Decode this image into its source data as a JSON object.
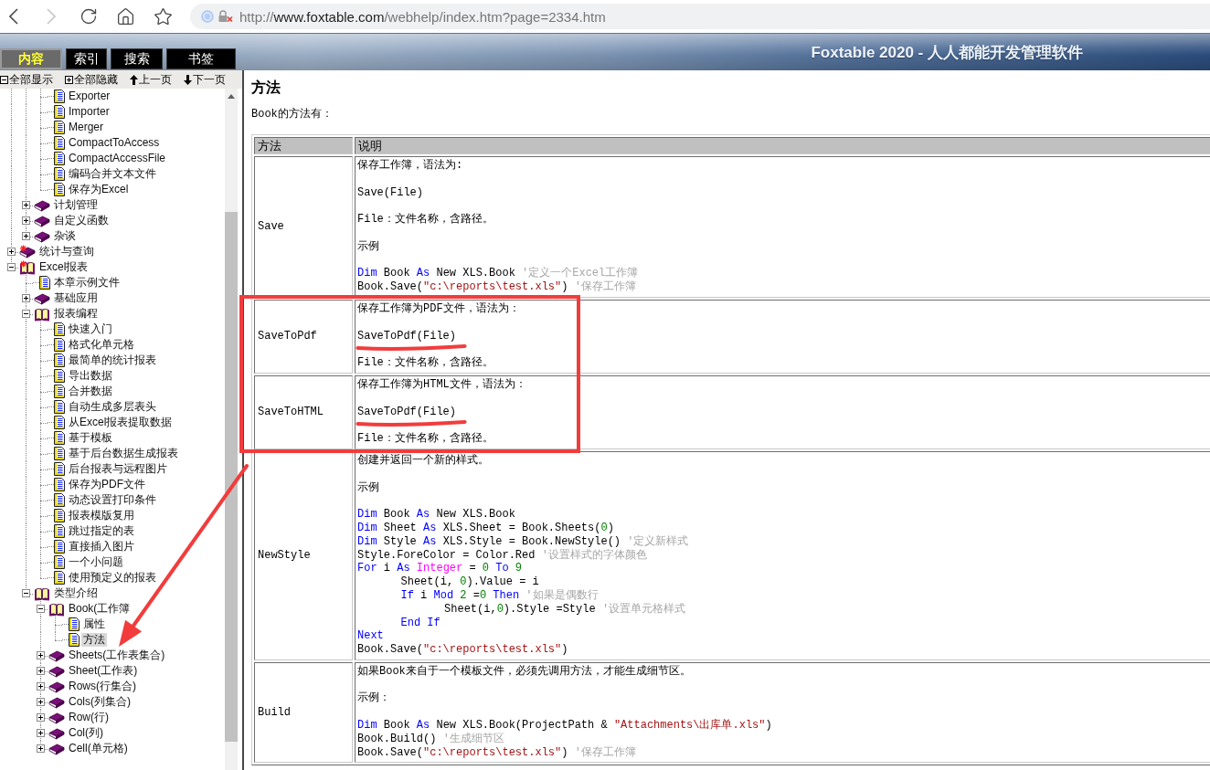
{
  "browser": {
    "back": {
      "disabled": false
    },
    "forward": {
      "disabled": true
    },
    "url": {
      "scheme": "http://",
      "host": "www.foxtable.com",
      "path": "/webhelp/index.htm?page=2334.htm"
    }
  },
  "header": {
    "tabs": [
      {
        "label": "内容",
        "selected": true
      },
      {
        "label": "索引",
        "selected": false
      },
      {
        "label": "搜索",
        "selected": false
      },
      {
        "label": "书签",
        "selected": false
      }
    ],
    "title": "Foxtable 2020 - 人人都能开发管理软件"
  },
  "sidebar": {
    "toolbar": [
      {
        "label": "全部显示",
        "kind": "minus"
      },
      {
        "label": "全部隐藏",
        "kind": "plus"
      },
      {
        "label": "上一页",
        "kind": "up"
      },
      {
        "label": "下一页",
        "kind": "down"
      }
    ],
    "tree": [
      {
        "children": [
          {
            "children": [
              {
                "label": "Exporter",
                "kind": "page",
                "selected": false
              },
              {
                "label": "Importer",
                "kind": "page",
                "selected": false
              },
              {
                "label": "Merger",
                "kind": "page",
                "selected": false
              },
              {
                "label": "CompactToAccess",
                "kind": "page",
                "selected": false
              },
              {
                "label": "CompactAccessFile",
                "kind": "page",
                "selected": false
              },
              {
                "label": "编码合并文本文件",
                "kind": "page",
                "selected": false
              },
              {
                "label": "保存为Excel",
                "kind": "page",
                "selected": false
              }
            ]
          },
          {
            "label": "计划管理",
            "kind": "book",
            "expanded": false,
            "selected": false
          },
          {
            "label": "自定义函数",
            "kind": "book",
            "expanded": false,
            "selected": false
          },
          {
            "label": "杂谈",
            "kind": "book",
            "expanded": false,
            "selected": false
          }
        ]
      },
      {
        "label": "统计与查询",
        "kind": "chapter",
        "expanded": false,
        "selected": false
      },
      {
        "label": "Excel报表",
        "kind": "chapter",
        "expanded": true,
        "selected": false,
        "children": [
          {
            "label": "本章示例文件",
            "kind": "page",
            "selected": false
          },
          {
            "label": "基础应用",
            "kind": "book",
            "expanded": false,
            "selected": false
          },
          {
            "label": "报表编程",
            "kind": "book",
            "expanded": true,
            "selected": false,
            "children": [
              {
                "label": "快速入门",
                "kind": "page",
                "selected": false
              },
              {
                "label": "格式化单元格",
                "kind": "page",
                "selected": false
              },
              {
                "label": "最简单的统计报表",
                "kind": "page",
                "selected": false
              },
              {
                "label": "导出数据",
                "kind": "page",
                "selected": false
              },
              {
                "label": "合并数据",
                "kind": "page",
                "selected": false
              },
              {
                "label": "自动生成多层表头",
                "kind": "page",
                "selected": false
              },
              {
                "label": "从Excel报表提取数据",
                "kind": "page",
                "selected": false
              },
              {
                "label": "基于模板",
                "kind": "page",
                "selected": false
              },
              {
                "label": "基于后台数据生成报表",
                "kind": "page",
                "selected": false
              },
              {
                "label": "后台报表与远程图片",
                "kind": "page",
                "selected": false
              },
              {
                "label": "保存为PDF文件",
                "kind": "page",
                "selected": false
              },
              {
                "label": "动态设置打印条件",
                "kind": "page",
                "selected": false
              },
              {
                "label": "报表模版复用",
                "kind": "page",
                "selected": false
              },
              {
                "label": "跳过指定的表",
                "kind": "page",
                "selected": false
              },
              {
                "label": "直接插入图片",
                "kind": "page",
                "selected": false
              },
              {
                "label": "一个小问题",
                "kind": "page",
                "selected": false
              },
              {
                "label": "使用预定义的报表",
                "kind": "page",
                "selected": false
              }
            ]
          },
          {
            "label": "类型介绍",
            "kind": "book",
            "expanded": true,
            "selected": false,
            "children": [
              {
                "label": "Book(工作簿",
                "kind": "book",
                "expanded": true,
                "selected": false,
                "children": [
                  {
                    "label": "属性",
                    "kind": "page",
                    "selected": false
                  },
                  {
                    "label": "方法",
                    "kind": "page",
                    "selected": true
                  }
                ]
              },
              {
                "label": "Sheets(工作表集合)",
                "kind": "book",
                "expanded": false,
                "selected": false
              },
              {
                "label": "Sheet(工作表)",
                "kind": "book",
                "expanded": false,
                "selected": false
              },
              {
                "label": "Rows(行集合)",
                "kind": "book",
                "expanded": false,
                "selected": false
              },
              {
                "label": "Cols(列集合)",
                "kind": "book",
                "expanded": false,
                "selected": false
              },
              {
                "label": "Row(行)",
                "kind": "book",
                "expanded": false,
                "selected": false
              },
              {
                "label": "Col(列)",
                "kind": "book",
                "expanded": false,
                "selected": false
              },
              {
                "label": "Cell(单元格)",
                "kind": "book",
                "expanded": false,
                "selected": false
              }
            ]
          }
        ]
      }
    ]
  },
  "content": {
    "title": "方法",
    "intro": "Book的方法有：",
    "table": {
      "columns": [
        "方法",
        "说明"
      ],
      "rows": [
        {
          "method": "Save",
          "highlighted": false,
          "blocks": [
            {
              "kind": "text",
              "text": "保存工作簿，语法为:",
              "underlined": false
            },
            {
              "kind": "text",
              "text": "Save(File)",
              "underlined": false
            },
            {
              "kind": "text",
              "text": "File：文件名称，含路径。",
              "underlined": false
            },
            {
              "kind": "text",
              "text": "示例",
              "underlined": false
            },
            {
              "kind": "code",
              "lines": [
                {
                  "tokens": [
                    {
                      "kind": "keyword",
                      "text": "Dim"
                    },
                    {
                      "kind": "plain",
                      "text": " Book "
                    },
                    {
                      "kind": "keyword",
                      "text": "As"
                    },
                    {
                      "kind": "plain",
                      "text": " New XLS.Book "
                    },
                    {
                      "kind": "comment",
                      "text": "'定义一个Excel工作簿"
                    }
                  ]
                },
                {
                  "tokens": [
                    {
                      "kind": "plain",
                      "text": "Book.Save("
                    },
                    {
                      "kind": "string",
                      "text": "\"c:\\reports\\test.xls\""
                    },
                    {
                      "kind": "plain",
                      "text": ") "
                    },
                    {
                      "kind": "comment",
                      "text": "'保存工作簿"
                    }
                  ]
                }
              ]
            }
          ]
        },
        {
          "method": "SaveToPdf",
          "highlighted": true,
          "blocks": [
            {
              "kind": "text",
              "text": "保存工作簿为PDF文件，语法为：",
              "underlined": false
            },
            {
              "kind": "text",
              "text": "SaveToPdf(File)",
              "underlined": true
            },
            {
              "kind": "text",
              "text": "File：文件名称，含路径。",
              "underlined": false
            }
          ]
        },
        {
          "method": "SaveToHTML",
          "highlighted": true,
          "blocks": [
            {
              "kind": "text",
              "text": "保存工作簿为HTML文件，语法为：",
              "underlined": false
            },
            {
              "kind": "text",
              "text": "SaveToPdf(File)",
              "underlined": true
            },
            {
              "kind": "text",
              "text": "File：文件名称，含路径。",
              "underlined": false
            }
          ]
        },
        {
          "method": "NewStyle",
          "highlighted": false,
          "blocks": [
            {
              "kind": "text",
              "text": "创建并返回一个新的样式。",
              "underlined": false
            },
            {
              "kind": "text",
              "text": "示例",
              "underlined": false
            },
            {
              "kind": "code",
              "lines": [
                {
                  "tokens": [
                    {
                      "kind": "keyword",
                      "text": "Dim"
                    },
                    {
                      "kind": "plain",
                      "text": " Book "
                    },
                    {
                      "kind": "keyword",
                      "text": "As"
                    },
                    {
                      "kind": "plain",
                      "text": " New XLS.Book"
                    }
                  ]
                },
                {
                  "tokens": [
                    {
                      "kind": "keyword",
                      "text": "Dim"
                    },
                    {
                      "kind": "plain",
                      "text": " Sheet "
                    },
                    {
                      "kind": "keyword",
                      "text": "As"
                    },
                    {
                      "kind": "plain",
                      "text": " XLS.Sheet = Book.Sheets("
                    },
                    {
                      "kind": "number",
                      "text": "0"
                    },
                    {
                      "kind": "plain",
                      "text": ")"
                    }
                  ]
                },
                {
                  "tokens": [
                    {
                      "kind": "keyword",
                      "text": "Dim"
                    },
                    {
                      "kind": "plain",
                      "text": " Style "
                    },
                    {
                      "kind": "keyword",
                      "text": "As"
                    },
                    {
                      "kind": "plain",
                      "text": " XLS.Style = Book.NewStyle() "
                    },
                    {
                      "kind": "comment",
                      "text": "'定义新样式"
                    }
                  ]
                },
                {
                  "tokens": [
                    {
                      "kind": "plain",
                      "text": "Style.ForeColor = Color.Red "
                    },
                    {
                      "kind": "comment",
                      "text": "'设置样式的字体颜色"
                    }
                  ]
                },
                {
                  "tokens": [
                    {
                      "kind": "keyword",
                      "text": "For"
                    },
                    {
                      "kind": "plain",
                      "text": " i "
                    },
                    {
                      "kind": "keyword",
                      "text": "As"
                    },
                    {
                      "kind": "type",
                      "text": " Integer"
                    },
                    {
                      "kind": "plain",
                      "text": " = "
                    },
                    {
                      "kind": "number",
                      "text": "0"
                    },
                    {
                      "kind": "keyword",
                      "text": " To"
                    },
                    {
                      "kind": "number",
                      "text": " 9"
                    }
                  ],
                  "children": [
                    {
                      "tokens": [
                        {
                          "kind": "plain",
                          "text": "Sheet(i, "
                        },
                        {
                          "kind": "number",
                          "text": "0"
                        },
                        {
                          "kind": "plain",
                          "text": ").Value = i"
                        }
                      ]
                    },
                    {
                      "tokens": [
                        {
                          "kind": "keyword",
                          "text": "If"
                        },
                        {
                          "kind": "plain",
                          "text": " i "
                        },
                        {
                          "kind": "keyword",
                          "text": "Mod"
                        },
                        {
                          "kind": "number",
                          "text": " 2"
                        },
                        {
                          "kind": "plain",
                          "text": " ="
                        },
                        {
                          "kind": "number",
                          "text": "0"
                        },
                        {
                          "kind": "keyword",
                          "text": " Then"
                        },
                        {
                          "kind": "comment",
                          "text": " '如果是偶数行"
                        }
                      ],
                      "children": [
                        {
                          "tokens": [
                            {
                              "kind": "plain",
                              "text": "Sheet(i,"
                            },
                            {
                              "kind": "number",
                              "text": "0"
                            },
                            {
                              "kind": "plain",
                              "text": ").Style =Style "
                            },
                            {
                              "kind": "comment",
                              "text": "'设置单元格样式"
                            }
                          ]
                        }
                      ]
                    },
                    {
                      "tokens": [
                        {
                          "kind": "keyword",
                          "text": "End If"
                        }
                      ]
                    }
                  ]
                },
                {
                  "tokens": [
                    {
                      "kind": "keyword",
                      "text": "Next"
                    }
                  ]
                },
                {
                  "tokens": [
                    {
                      "kind": "plain",
                      "text": "Book.Save("
                    },
                    {
                      "kind": "string",
                      "text": "\"c:\\reports\\test.xls\""
                    },
                    {
                      "kind": "plain",
                      "text": ")"
                    }
                  ]
                }
              ]
            }
          ]
        },
        {
          "method": "Build",
          "highlighted": false,
          "blocks": [
            {
              "kind": "text",
              "text": "如果Book来自于一个模板文件，必须先调用方法，才能生成细节区。",
              "underlined": false
            },
            {
              "kind": "text",
              "text": "示例：",
              "underlined": false
            },
            {
              "kind": "code",
              "lines": [
                {
                  "tokens": [
                    {
                      "kind": "keyword",
                      "text": "Dim"
                    },
                    {
                      "kind": "plain",
                      "text": " Book "
                    },
                    {
                      "kind": "keyword",
                      "text": "As"
                    },
                    {
                      "kind": "plain",
                      "text": " New XLS.Book(ProjectPath & "
                    },
                    {
                      "kind": "string",
                      "text": "\"Attachments\\出库单.xls\""
                    },
                    {
                      "kind": "plain",
                      "text": ")"
                    }
                  ]
                },
                {
                  "tokens": [
                    {
                      "kind": "plain",
                      "text": "Book.Build() "
                    },
                    {
                      "kind": "comment",
                      "text": "'生成细节区"
                    }
                  ]
                },
                {
                  "tokens": [
                    {
                      "kind": "plain",
                      "text": "Book.Save("
                    },
                    {
                      "kind": "string",
                      "text": "\"c:\\reports\\test.xls\""
                    },
                    {
                      "kind": "plain",
                      "text": ") "
                    },
                    {
                      "kind": "comment",
                      "text": "'保存工作簿"
                    }
                  ]
                }
              ]
            }
          ]
        }
      ]
    }
  }
}
